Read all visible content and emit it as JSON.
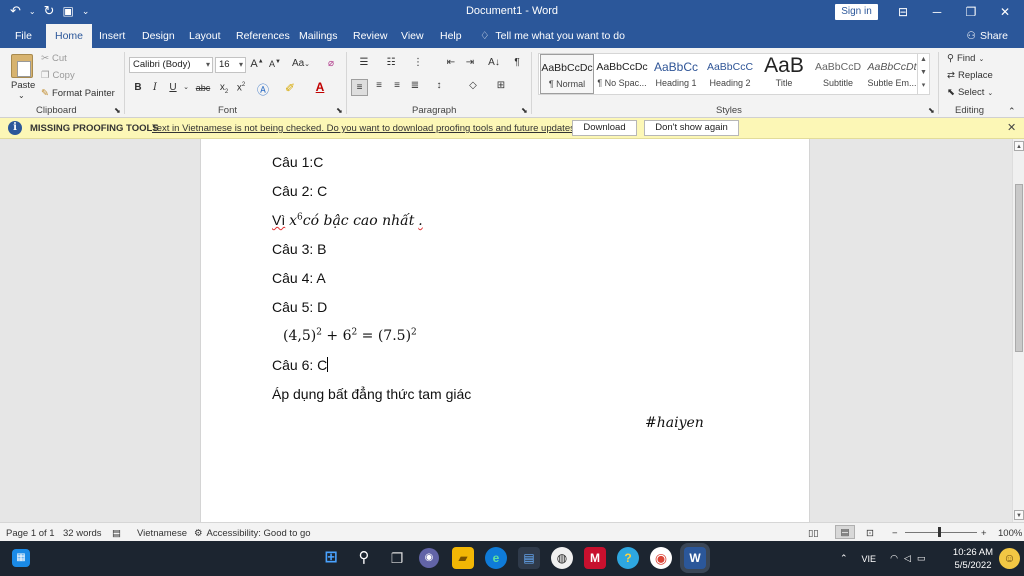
{
  "titlebar": {
    "title": "Document1 - Word",
    "sign_in": "Sign in",
    "qat_icons": [
      "undo-icon",
      "redo-icon",
      "save-icon",
      "customize-qat-icon"
    ],
    "min": "─",
    "restore": "❐",
    "close": "✕"
  },
  "tabs": [
    "File",
    "Home",
    "Insert",
    "Design",
    "Layout",
    "References",
    "Mailings",
    "Review",
    "View",
    "Help"
  ],
  "tell_me": "Tell me what you want to do",
  "share": "Share",
  "ribbon": {
    "clipboard": {
      "label": "Clipboard",
      "paste": "Paste",
      "cut": "Cut",
      "copy": "Copy",
      "format_painter": "Format Painter"
    },
    "font": {
      "label": "Font",
      "family": "Calibri (Body)",
      "size": "16",
      "grow": "A",
      "shrink": "A",
      "case": "Aa",
      "bold": "B",
      "italic": "I",
      "underline": "U",
      "strike": "abc",
      "sub": "x",
      "sup": "x"
    },
    "paragraph": {
      "label": "Paragraph",
      "sort": "A↓",
      "pilcrow": "¶"
    },
    "styles": {
      "label": "Styles",
      "items": [
        {
          "preview": "AaBbCcDc",
          "name": "¶ Normal"
        },
        {
          "preview": "AaBbCcDc",
          "name": "¶ No Spac..."
        },
        {
          "preview": "AaBbCc",
          "name": "Heading 1"
        },
        {
          "preview": "AaBbCcC",
          "name": "Heading 2"
        },
        {
          "preview": "AaB",
          "name": "Title"
        },
        {
          "preview": "AaBbCcD",
          "name": "Subtitle"
        },
        {
          "preview": "AaBbCcDt",
          "name": "Subtle Em..."
        }
      ]
    },
    "editing": {
      "label": "Editing",
      "find": "Find",
      "replace": "Replace",
      "select": "Select"
    }
  },
  "message_bar": {
    "title": "MISSING PROOFING TOOLS",
    "text": "Text in Vietnamese is not being checked. Do you want to download proofing tools and future updates?",
    "download": "Download",
    "dont_show": "Don't show again"
  },
  "document": {
    "lines": {
      "l1": "Câu 1:C",
      "l2": "Câu 2: C",
      "l3_prefix": "Vì",
      "l3_x": "x",
      "l3_exp": "6",
      "l3_rest": "có bậc cao nhất",
      "l3_end": ".",
      "l4": "Câu 3: B",
      "l5": "Câu 4: A",
      "l6": "Câu 5: D",
      "eq_a": "(4,5)",
      "eq_a_exp": "2",
      "eq_plus": " + 6",
      "eq_b_exp": "2",
      "eq_eq": " = (7.5)",
      "eq_c_exp": "2",
      "l8": "Câu 6: C",
      "l9": "Áp dụng bất đẳng thức tam giác",
      "signature": "#haiyen"
    }
  },
  "statusbar": {
    "page": "Page 1 of 1",
    "words": "32 words",
    "language": "Vietnamese",
    "accessibility": "Accessibility: Good to go",
    "zoom": "100%"
  },
  "taskbar": {
    "lang": "VIE",
    "time": "10:26 AM",
    "date": "5/5/2022"
  }
}
